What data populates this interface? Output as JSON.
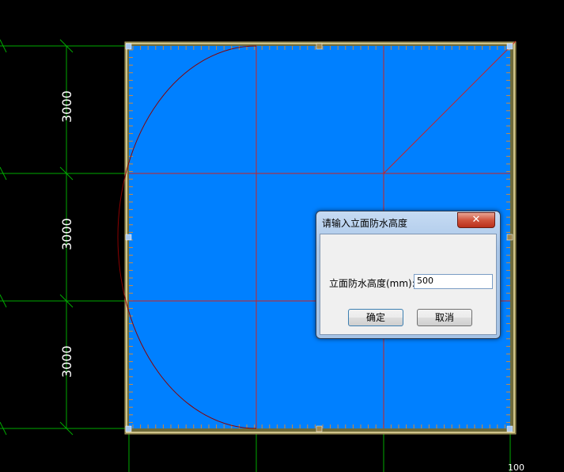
{
  "drawing": {
    "dimensions": [
      "3000",
      "3000",
      "3000"
    ],
    "corner_label": "100",
    "colors": {
      "background": "#000000",
      "region_fill": "#0080ff",
      "grid_line": "#cc2222",
      "axis_line": "#00aa00",
      "arc_line": "#8b0000"
    }
  },
  "dialog": {
    "title": "请输入立面防水高度",
    "close_symbol": "✕",
    "field_label": "立面防水高度(mm):",
    "field_value": "500",
    "ok_label": "确定",
    "cancel_label": "取消"
  }
}
